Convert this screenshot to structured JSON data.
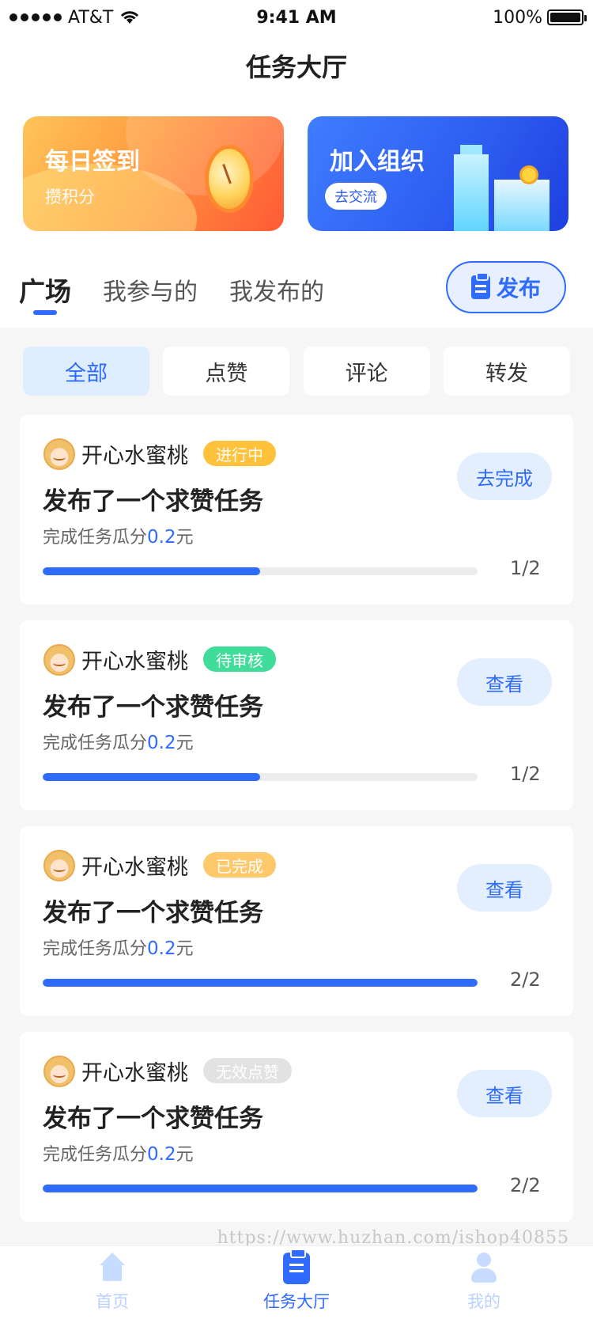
{
  "status_bar": {
    "carrier": "AT&T",
    "time": "9:41 AM",
    "battery": "100%"
  },
  "nav": {
    "title": "任务大厅"
  },
  "banners": [
    {
      "title": "每日签到",
      "subtitle": "攒积分",
      "icon": "clock-icon"
    },
    {
      "title": "加入组织",
      "button": "去交流",
      "icon": "buildings-icon"
    }
  ],
  "tabs": {
    "items": [
      "广场",
      "我参与的",
      "我发布的"
    ],
    "active": "广场",
    "publish_label": "发布"
  },
  "filters": {
    "items": [
      "全部",
      "点赞",
      "评论",
      "转发"
    ],
    "active": "全部"
  },
  "tasks": [
    {
      "user": "开心水蜜桃",
      "status": "进行中",
      "status_color": "#ffc23a",
      "title": "发布了一个求赞任务",
      "reward_prefix": "完成任务瓜分",
      "reward_amount": "0.2",
      "reward_unit": "元",
      "progress_text": "1/2",
      "progress": 0.5,
      "action": "去完成"
    },
    {
      "user": "开心水蜜桃",
      "status": "待审核",
      "status_color": "#40dc9a",
      "title": "发布了一个求赞任务",
      "reward_prefix": "完成任务瓜分",
      "reward_amount": "0.2",
      "reward_unit": "元",
      "progress_text": "1/2",
      "progress": 0.5,
      "action": "查看"
    },
    {
      "user": "开心水蜜桃",
      "status": "已完成",
      "status_color": "#ffc86b",
      "title": "发布了一个求赞任务",
      "reward_prefix": "完成任务瓜分",
      "reward_amount": "0.2",
      "reward_unit": "元",
      "progress_text": "2/2",
      "progress": 1.0,
      "action": "查看"
    },
    {
      "user": "开心水蜜桃",
      "status": "无效点赞",
      "status_color": "#e2e2e2",
      "title": "发布了一个求赞任务",
      "reward_prefix": "完成任务瓜分",
      "reward_amount": "0.2",
      "reward_unit": "元",
      "progress_text": "2/2",
      "progress": 1.0,
      "action": "查看"
    }
  ],
  "watermark": "https://www.huzhan.com/ishop40855",
  "bottom_nav": [
    {
      "label": "首页",
      "icon": "home-icon",
      "color": "#b9d2ff"
    },
    {
      "label": "任务大厅",
      "icon": "task-icon",
      "color": "#2f6bff"
    },
    {
      "label": "我的",
      "icon": "user-icon",
      "color": "#b9d2ff"
    }
  ],
  "colors": {
    "accent": "#2f6bff",
    "background": "#f6f6f6"
  }
}
